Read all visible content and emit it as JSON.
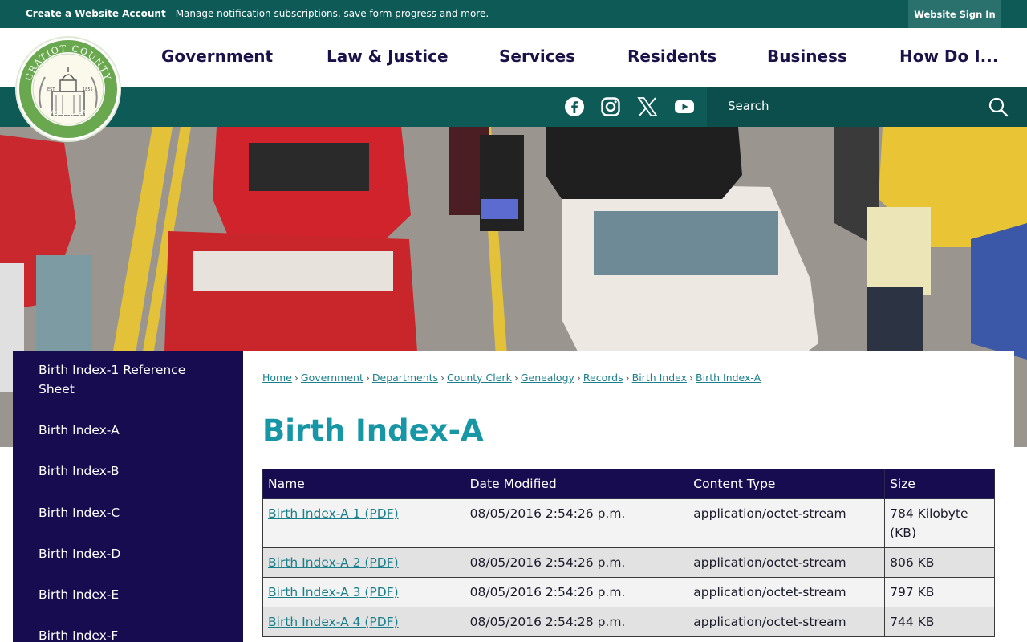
{
  "topbar": {
    "account_link": "Create a Website Account",
    "account_desc": "- Manage notification subscriptions, save form progress and more.",
    "signin": "Website Sign In"
  },
  "logo": {
    "top_text": "GRATIOT COUNTY",
    "bottom_text": "MICHIGAN",
    "est": "EST",
    "year": "1855",
    "colors": {
      "ring": "#6aa84f",
      "inner": "#ffffff"
    }
  },
  "nav": {
    "items": [
      "Government",
      "Law & Justice",
      "Services",
      "Residents",
      "Business",
      "How Do I..."
    ]
  },
  "social": [
    "facebook-icon",
    "instagram-icon",
    "x-icon",
    "youtube-icon"
  ],
  "search": {
    "placeholder": "Search"
  },
  "sidebar": {
    "items": [
      "Birth Index-1 Reference Sheet",
      "Birth Index-A",
      "Birth Index-B",
      "Birth Index-C",
      "Birth Index-D",
      "Birth Index-E",
      "Birth Index-F"
    ]
  },
  "breadcrumb": [
    "Home",
    "Government",
    "Departments",
    "County Clerk",
    "Genealogy",
    "Records",
    "Birth Index",
    "Birth Index-A"
  ],
  "page": {
    "title": "Birth Index-A"
  },
  "table": {
    "headers": [
      "Name",
      "Date Modified",
      "Content Type",
      "Size"
    ],
    "rows": [
      {
        "name": "Birth Index-A 1 (PDF)",
        "date": "08/05/2016 2:54:26 p.m.",
        "type": "application/octet-stream",
        "size": "784 Kilobyte (KB)"
      },
      {
        "name": "Birth Index-A 2 (PDF)",
        "date": "08/05/2016 2:54:26 p.m.",
        "type": "application/octet-stream",
        "size": "806 KB"
      },
      {
        "name": "Birth Index-A 3 (PDF)",
        "date": "08/05/2016 2:54:26 p.m.",
        "type": "application/octet-stream",
        "size": "797 KB"
      },
      {
        "name": "Birth Index-A 4 (PDF)",
        "date": "08/05/2016 2:54:28 p.m.",
        "type": "application/octet-stream",
        "size": "744 KB"
      }
    ]
  },
  "colors": {
    "teal": "#0e5a57",
    "navy": "#160c4f",
    "title": "#1796a5",
    "link": "#1a7f8a"
  }
}
